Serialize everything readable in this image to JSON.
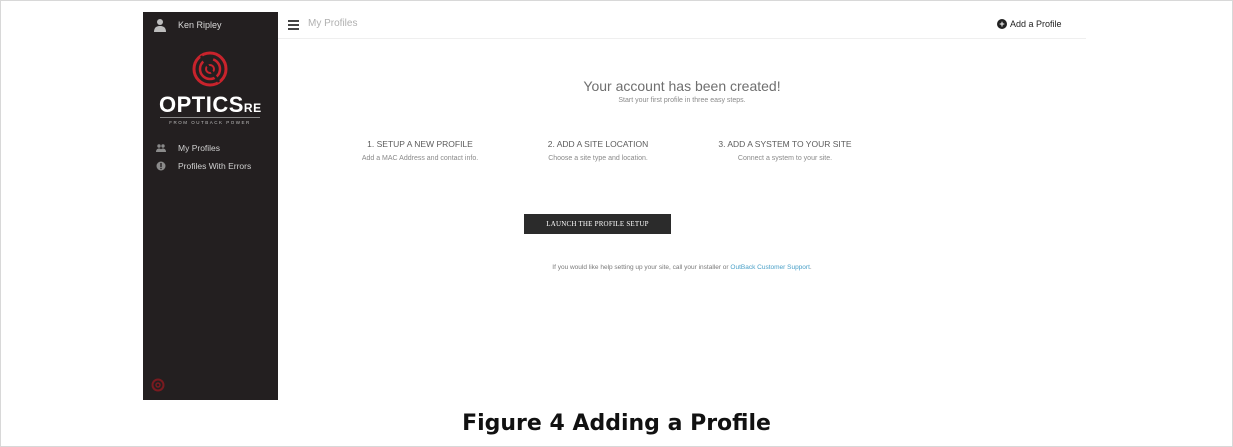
{
  "sidebar": {
    "user_name": "Ken Ripley",
    "logo": {
      "text": "OPTICS",
      "suffix": "RE",
      "tagline": "FROM OUTBACK POWER"
    },
    "items": [
      {
        "label": "My Profiles",
        "icon": "users-icon"
      },
      {
        "label": "Profiles With Errors",
        "icon": "alert-circle-icon"
      }
    ]
  },
  "header": {
    "title": "My Profiles",
    "add_profile_label": "Add a Profile"
  },
  "main": {
    "headline": "Your account has been created!",
    "subline": "Start your first profile in three easy steps.",
    "steps": [
      {
        "title": "1. SETUP A NEW PROFILE",
        "desc": "Add a MAC Address and contact info."
      },
      {
        "title": "2. ADD A SITE LOCATION",
        "desc": "Choose a site type and location."
      },
      {
        "title": "3. ADD A SYSTEM TO YOUR SITE",
        "desc": "Connect a system to your site."
      }
    ],
    "launch_button": "LAUNCH THE PROFILE SETUP",
    "help_text": "If you would like help setting up your site, call your installer or ",
    "help_link": "OutBack Customer Support",
    "help_end": "."
  },
  "caption": "Figure 4   Adding a Profile",
  "colors": {
    "sidebar_bg": "#231f20",
    "brand_red": "#c8232c",
    "button_bg": "#2b2b2b",
    "link": "#4aa0c8"
  }
}
